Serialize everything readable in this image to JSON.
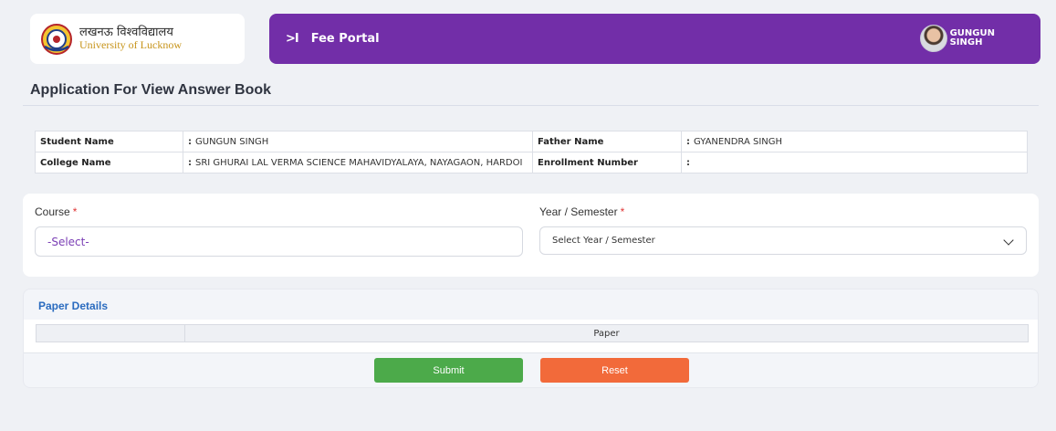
{
  "brand": {
    "hindi_name": "लखनऊ विश्वविद्यालय",
    "english_name": "University of Lucknow"
  },
  "topbar": {
    "toggle_label": ">I",
    "title": "Fee Portal",
    "user_line1": "GUNGUN",
    "user_line2": "SINGH",
    "bg_color": "#722ea8"
  },
  "page": {
    "title": "Application For View Answer Book"
  },
  "student_info": {
    "student_name_label": "Student Name",
    "student_name": "GUNGUN SINGH",
    "father_name_label": "Father Name",
    "father_name": "GYANENDRA SINGH",
    "college_name_label": "College Name",
    "college_name": "SRI GHURAI LAL VERMA SCIENCE MAHAVIDYALAYA, NAYAGAON, HARDOI",
    "enrollment_label": "Enrollment Number",
    "enrollment_number": "",
    "colon": ":"
  },
  "form": {
    "course_label": "Course",
    "course_value": "-Select-",
    "year_label": "Year / Semester",
    "year_value": "Select Year / Semester",
    "required_mark": "*"
  },
  "paper_details": {
    "heading": "Paper Details",
    "columns": [
      "",
      "Paper"
    ]
  },
  "actions": {
    "submit_label": "Submit",
    "reset_label": "Reset",
    "submit_color": "#4caa4a",
    "reset_color": "#f26a3a"
  }
}
